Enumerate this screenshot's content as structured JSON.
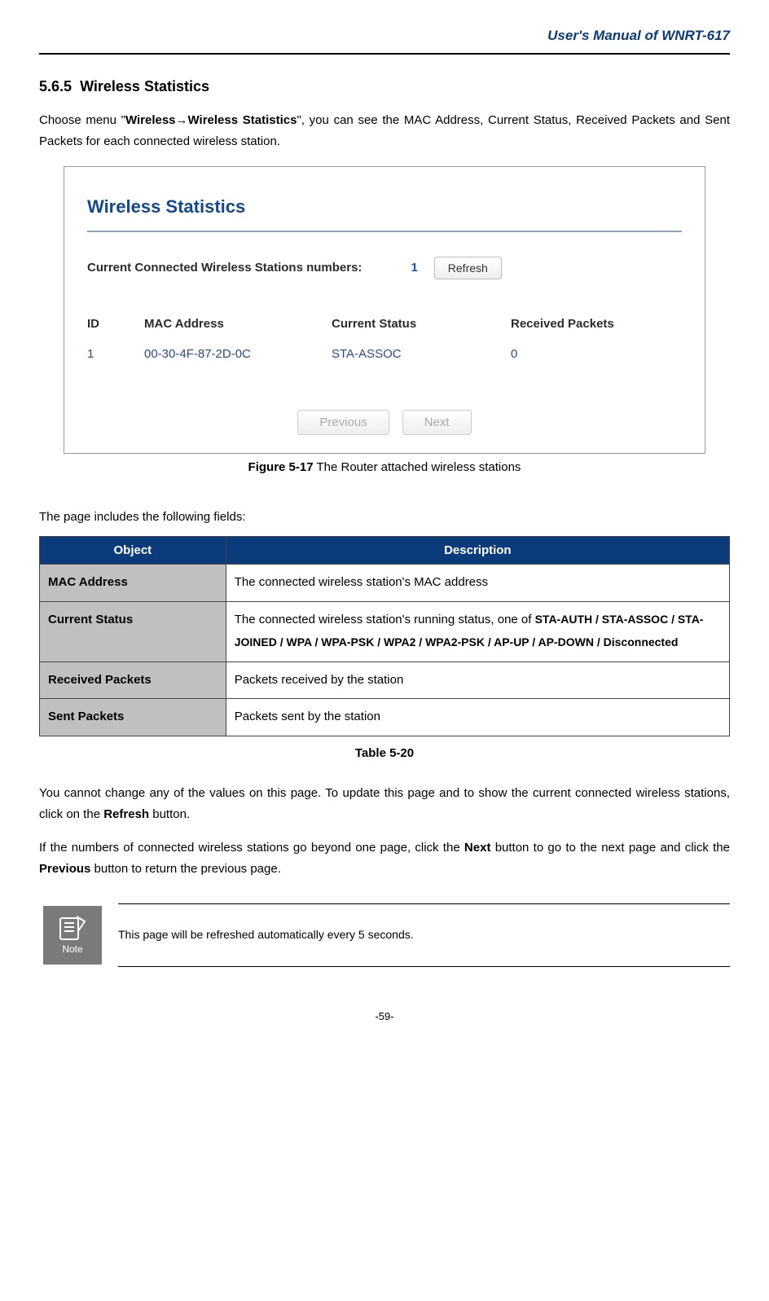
{
  "header": {
    "title": "User's Manual of WNRT-617"
  },
  "section": {
    "number": "5.6.5",
    "title": "Wireless Statistics"
  },
  "intro": {
    "prefix": "Choose menu \"",
    "menu_path": "Wireless→Wireless Statistics",
    "suffix": "\", you can see the MAC Address, Current Status, Received Packets and Sent Packets for each connected wireless station."
  },
  "figure": {
    "panel_title": "Wireless Statistics",
    "connected_label": "Current Connected Wireless Stations numbers:",
    "connected_count": "1",
    "refresh_label": "Refresh",
    "headers": {
      "id": "ID",
      "mac": "MAC Address",
      "status": "Current Status",
      "received": "Received Packets"
    },
    "row": {
      "id": "1",
      "mac": "00-30-4F-87-2D-0C",
      "status": "STA-ASSOC",
      "received": "0"
    },
    "prev_label": "Previous",
    "next_label": "Next",
    "caption_bold": "Figure 5-17",
    "caption_rest": " The Router attached wireless stations"
  },
  "fields_intro": "The page includes the following fields:",
  "def_table": {
    "col1": "Object",
    "col2": "Description",
    "rows": [
      {
        "obj": "MAC Address",
        "desc_plain": "The connected wireless station's MAC address"
      },
      {
        "obj": "Current Status",
        "desc_prefix": "The connected wireless station's running status, one of ",
        "desc_bold": "STA-AUTH / STA-ASSOC / STA-JOINED / WPA / WPA-PSK / WPA2 / WPA2-PSK / AP-UP / AP-DOWN / Disconnected"
      },
      {
        "obj": "Received Packets",
        "desc_plain": "Packets received by the station"
      },
      {
        "obj": "Sent Packets",
        "desc_plain": "Packets sent by the station"
      }
    ],
    "caption": "Table 5-20"
  },
  "para1": {
    "p1": "You cannot change any of the values on this page. To update this page and to show the current connected wireless stations, click on the ",
    "b1": "Refresh",
    "p2": " button."
  },
  "para2": {
    "p1": "If the numbers of connected wireless stations go beyond one page, click the ",
    "b1": "Next",
    "p2": " button to go to the next page and click the ",
    "b2": "Previous",
    "p3": " button to return the previous page."
  },
  "note": {
    "label": "Note",
    "text": "This page will be refreshed automatically every 5 seconds."
  },
  "page_number": "-59-"
}
